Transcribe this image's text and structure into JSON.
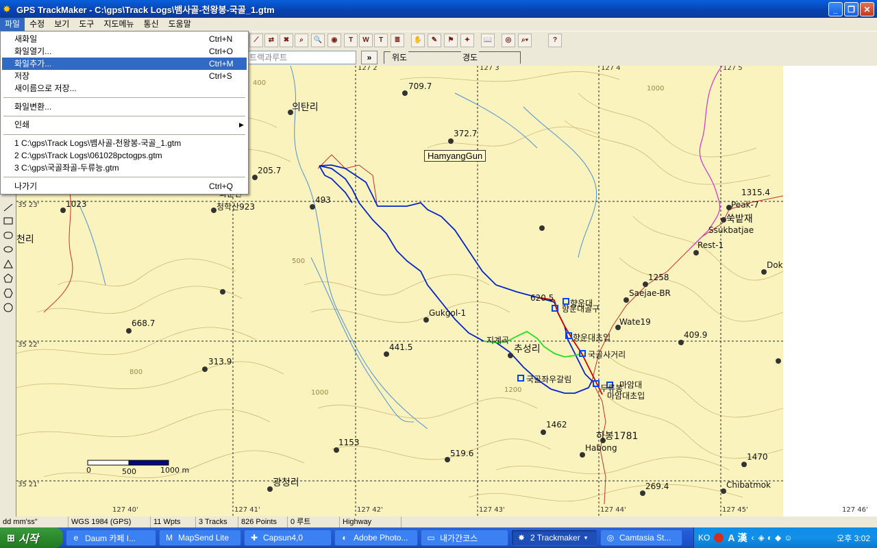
{
  "window": {
    "title": "GPS TrackMaker - C:\\gps\\Track Logs\\뱀사골-천왕봉-국골_1.gtm"
  },
  "menubar": [
    "파일",
    "수정",
    "보기",
    "도구",
    "지도메뉴",
    "통신",
    "도움말"
  ],
  "toolbar": {
    "route_placeholder": "트랙과루트",
    "go_label": "»",
    "lat_label": "위도",
    "lon_label": "경도"
  },
  "file_menu": {
    "items": [
      {
        "label": "새화일",
        "shortcut": "Ctrl+N"
      },
      {
        "label": "화일열기...",
        "shortcut": "Ctrl+O"
      },
      {
        "label": "화일추가...",
        "shortcut": "Ctrl+M"
      },
      {
        "label": "저장",
        "shortcut": "Ctrl+S"
      },
      {
        "label": "새이름으로 저장...",
        "shortcut": ""
      },
      {
        "label": "화일변환...",
        "shortcut": ""
      },
      {
        "label": "인쇄",
        "shortcut": ""
      },
      {
        "label": "1 C:\\gps\\Track Logs\\뱀사골-천왕봉-국골_1.gtm",
        "shortcut": ""
      },
      {
        "label": "2 C:\\gps\\Track Logs\\061028pctogps.gtm",
        "shortcut": ""
      },
      {
        "label": "3 C:\\gps\\국골좌골-두류능.gtm",
        "shortcut": ""
      },
      {
        "label": "나가기",
        "shortcut": "Ctrl+Q"
      }
    ],
    "highlighted": "화일추가..."
  },
  "map": {
    "region_label": "HamyangGun",
    "grid_lat": [
      "35 23'",
      "35 22'",
      "35 21'"
    ],
    "grid_lon": [
      "127 40'",
      "127 41'",
      "127 42'",
      "127 43'",
      "127 44'",
      "127 45'",
      "127 46'"
    ],
    "top_lon": [
      "127 2",
      "127 3",
      "127 4",
      "127 5"
    ],
    "labels": {
      "l1": "709.7",
      "l2": "의탄리",
      "l3": "372.7",
      "l4": "205.7",
      "l5": "1023",
      "l6": "와운면",
      "l7": "청학산923",
      "l8": "493",
      "l9": "천리",
      "l10": "1315.4",
      "l11": "Peak-7",
      "l12": "쑥밭재",
      "l13": "Ssukbatjae",
      "l14": "Rest-1",
      "l15": "Dok",
      "l16": "1258",
      "l17": "Saejae-BR",
      "l18": "620.5",
      "l19": "향운대",
      "l20": "향운대골구",
      "l21": "Wate19",
      "l22": "668.7",
      "l23": "Gukgol-1",
      "l24": "향운대초입",
      "l25": "409.9",
      "l26": "지계곡",
      "l27": "441.5",
      "l28": "추성리",
      "l29": "국골사거리",
      "l30": "313.9",
      "l31": "국골좌우갈림",
      "l32": "마암대",
      "l33": "두류봉",
      "l34": "마암대초입",
      "l35": "1462",
      "l36": "하봉1781",
      "l37": "1153",
      "l38": "519.6",
      "l39": "Habong",
      "l40": "1470",
      "l41": "광청리",
      "l42": "269.4",
      "l43": "Chibatmok",
      "c400": "400",
      "c1000": "1000",
      "c500": "500",
      "c800": "800",
      "c1200": "1200",
      "c1000b": "1000"
    },
    "scale": {
      "s0": "0",
      "s500": "500",
      "s1000": "1000 m"
    }
  },
  "statusbar": {
    "format": "dd mm'ss\"",
    "datum": "WGS 1984 (GPS)",
    "wpts": "11 Wpts",
    "tracks": "3 Tracks",
    "points": "826 Points",
    "routes": "0 루트",
    "road": "Highway"
  },
  "taskbar": {
    "start": "시작",
    "tasks": [
      {
        "label": "Daum 카페 I...",
        "icon": "ie-icon"
      },
      {
        "label": "MapSend Lite",
        "icon": "mapsend-icon"
      },
      {
        "label": "Capsun4,0",
        "icon": "capsun-icon"
      },
      {
        "label": "Adobe Photo...",
        "icon": "photoshop-icon"
      },
      {
        "label": "내가간코스",
        "icon": "folder-icon"
      },
      {
        "label": "2 Trackmaker",
        "icon": "trackmaker-icon"
      },
      {
        "label": "Camtasia St...",
        "icon": "camtasia-icon"
      }
    ],
    "lang": "KO",
    "ime_a": "A",
    "ime_han": "漢",
    "clock": "오후 3:02"
  },
  "colors": {
    "title_blue": "#0842b0",
    "map_bg": "#fbf3bd",
    "track_blue": "#0022cc",
    "track_green": "#22dd22",
    "track_red": "#cc0000",
    "highlight": "#316ac5"
  }
}
